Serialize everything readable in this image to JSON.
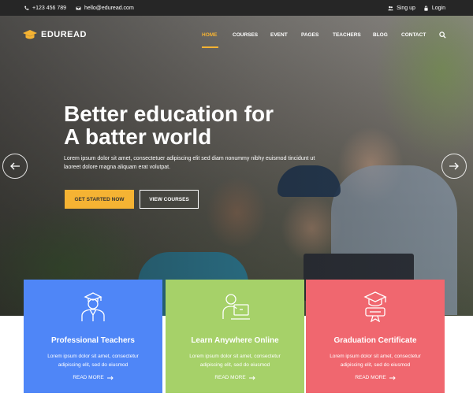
{
  "topbar": {
    "phone": "+123 456 789",
    "email": "hello@eduread.com",
    "signup": "Sing up",
    "login": "Login"
  },
  "brand": {
    "name": "EDUREAD",
    "accent": "#f5b333"
  },
  "nav": {
    "items": [
      {
        "label": "HOME",
        "active": true
      },
      {
        "label": "COURSES"
      },
      {
        "label": "EVENT"
      },
      {
        "label": "PAGES"
      },
      {
        "label": "TEACHERS"
      },
      {
        "label": "BLOG"
      },
      {
        "label": "CONTACT"
      }
    ],
    "search_icon": "search-icon"
  },
  "hero": {
    "headline_line1": "Better education for",
    "headline_line2": "A batter world",
    "subtitle": "Lorem ipsum dolor sit amet, consectetuer adipiscing elit sed diam nonummy nibhy euismod tincidunt ut laoreet dolore magna aliquam erat volutpat.",
    "cta_primary": "GET STARTED NOW",
    "cta_secondary": "VIEW COURSES"
  },
  "features": [
    {
      "title": "Professional Teachers",
      "desc": "Lorem ipsum dolor sit amet, consectetur adipiscing elit, sed do eiusmod",
      "link": "READ MORE",
      "color": "#4f86f7",
      "icon": "teacher-icon"
    },
    {
      "title": "Learn Anywhere Online",
      "desc": "Lorem ipsum dolor sit amet, consectetur adipiscing elit, sed do eiusmod",
      "link": "READ MORE",
      "color": "#a6d169",
      "icon": "online-learning-icon"
    },
    {
      "title": "Graduation Certificate",
      "desc": "Lorem ipsum dolor sit amet, consectetur adipiscing elit, sed do eiusmod",
      "link": "READ MORE",
      "color": "#f0676f",
      "icon": "certificate-icon"
    }
  ]
}
